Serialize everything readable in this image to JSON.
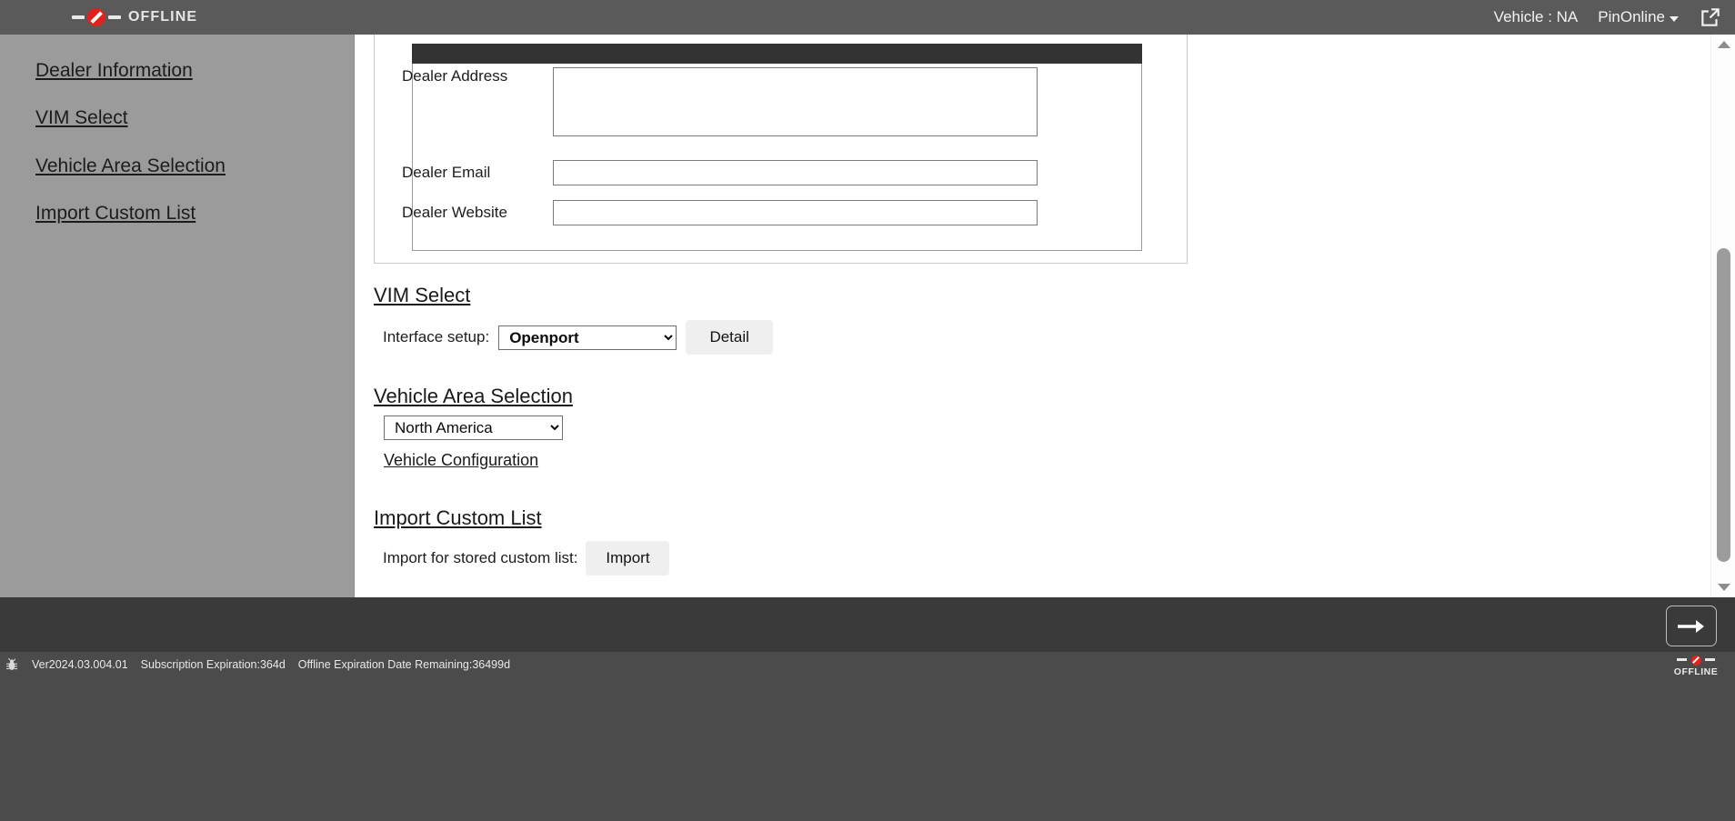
{
  "topbar": {
    "offline_label": "OFFLINE",
    "offline_icon": "no-entry-icon",
    "vehicle_status": "Vehicle : NA",
    "pin_label": "PinOnline",
    "pin_caret_icon": "caret-down-icon",
    "external_link_icon": "external-link-icon"
  },
  "sidebar": {
    "items": [
      {
        "label": "Dealer Information"
      },
      {
        "label": "VIM Select"
      },
      {
        "label": "Vehicle Area Selection"
      },
      {
        "label": "Import Custom List"
      }
    ]
  },
  "dealer_panel": {
    "fields": [
      {
        "label": "Dealer Address",
        "value": "",
        "placeholder": ""
      },
      {
        "label": "Dealer Email",
        "value": "",
        "placeholder": ""
      },
      {
        "label": "Dealer Website",
        "value": "",
        "placeholder": ""
      }
    ]
  },
  "vim_select": {
    "title": "VIM Select",
    "interface_label": "Interface setup:",
    "interface_value": "Openport",
    "interface_options": [
      "Openport"
    ],
    "detail_button": "Detail"
  },
  "vehicle_area": {
    "title": "Vehicle Area Selection",
    "area_value": "North America",
    "area_options": [
      "North America"
    ],
    "config_link": "Vehicle Configuration"
  },
  "import_custom_list": {
    "title": "Import Custom List",
    "import_label": "Import for stored custom list:",
    "import_button": "Import"
  },
  "bottombar": {
    "next_icon": "arrow-right-icon"
  },
  "statusbar": {
    "bug_icon": "bug-icon",
    "version": "Ver2024.03.004.01",
    "subscription": "Subscription Expiration:364d",
    "offline_expiration": "Offline Expiration Date Remaining:36499d",
    "offline_label": "OFFLINE",
    "offline_icon": "no-entry-icon"
  },
  "scrollbar": {
    "up_icon": "chevron-up-icon",
    "down_icon": "chevron-down-icon"
  },
  "colors": {
    "topbar": "#5a5a5a",
    "sidebar": "#9b9b9b",
    "panel_header": "#333333",
    "bottombar": "#3a3a3a",
    "statusbar": "#4b4b4b",
    "accent_red": "#e2211c"
  }
}
